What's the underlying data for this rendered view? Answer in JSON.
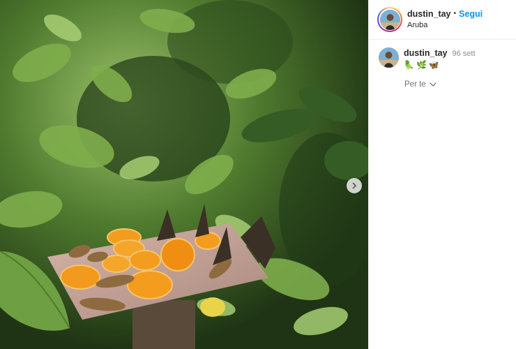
{
  "post": {
    "author": "dustin_tay",
    "separator": "•",
    "follow_label": "Segui",
    "location": "Aruba"
  },
  "caption": {
    "username": "dustin_tay",
    "time": "96 sett",
    "emojis": [
      "🦜",
      "🌿",
      "🦋"
    ]
  },
  "feed_filter": {
    "label": "Per te"
  },
  "icons": {
    "carousel_next": "chevron-right-icon",
    "filter_dropdown": "chevron-down-icon"
  },
  "colors": {
    "follow_blue": "#0095f6",
    "muted_text": "#8e8e8e"
  }
}
